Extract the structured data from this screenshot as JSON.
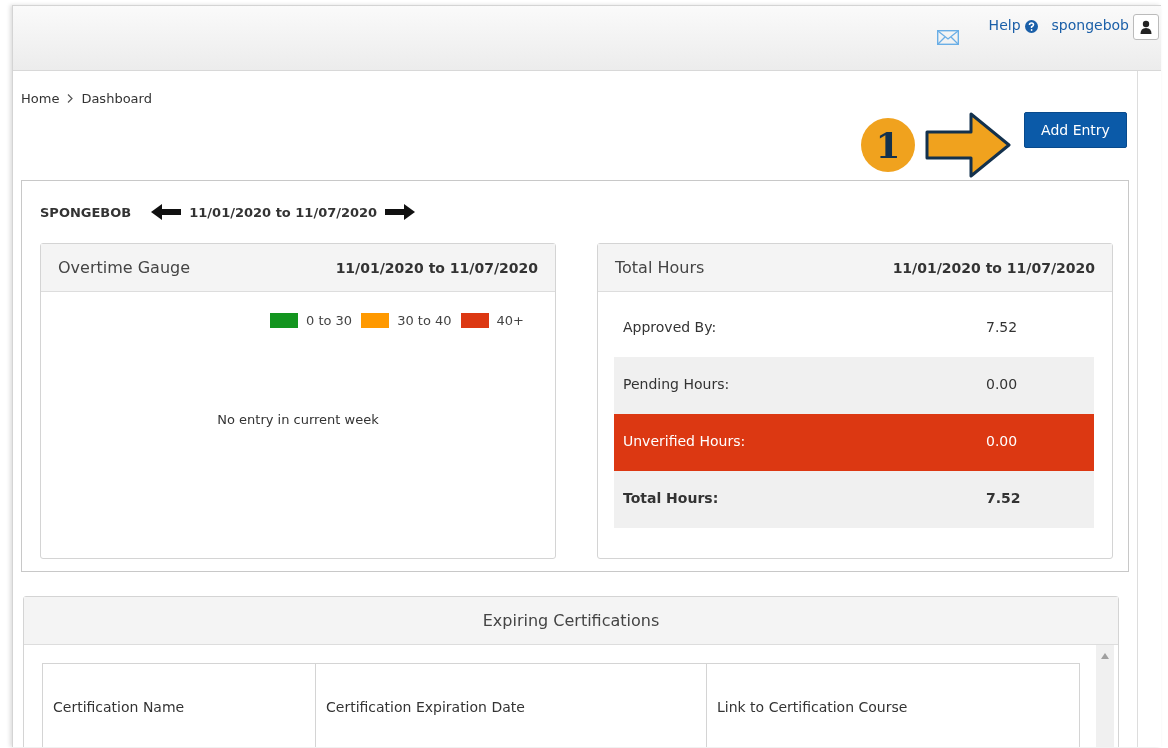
{
  "header": {
    "help_label": "Help",
    "user_name": "spongebob"
  },
  "breadcrumb": [
    "Home",
    "Dashboard"
  ],
  "callout": {
    "number": "1"
  },
  "add_button": "Add Entry",
  "summary": {
    "employee": "SPONGEBOB",
    "period": "11/01/2020 to 11/07/2020",
    "overtime_gauge": {
      "title": "Overtime Gauge",
      "period": "11/01/2020 to 11/07/2020",
      "legend": [
        {
          "label": "0 to 30",
          "color": "#13951f"
        },
        {
          "label": "30 to 40",
          "color": "#ff9900"
        },
        {
          "label": "40+",
          "color": "#dc3812"
        }
      ],
      "message": "No entry in current week"
    },
    "total_hours": {
      "title": "Total Hours",
      "period": "11/01/2020 to 11/07/2020",
      "rows": [
        {
          "label": "Approved By:",
          "value": "7.52",
          "kind": "plain"
        },
        {
          "label": "Pending Hours:",
          "value": "0.00",
          "kind": "shaded"
        },
        {
          "label": "Unverified Hours:",
          "value": "0.00",
          "kind": "alert"
        },
        {
          "label": "Total Hours:",
          "value": "7.52",
          "kind": "total"
        }
      ]
    }
  },
  "certifications": {
    "title": "Expiring Certifications",
    "columns": [
      "Certification Name",
      "Certification Expiration Date",
      "Link to Certification Course"
    ]
  }
}
